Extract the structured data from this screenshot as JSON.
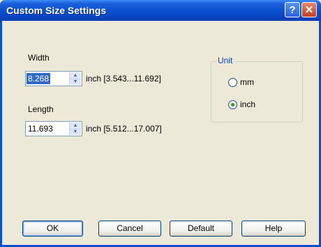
{
  "window": {
    "title": "Custom Size Settings",
    "help_glyph": "?",
    "close_glyph": "✕"
  },
  "width": {
    "label": "Width",
    "value": "8.268",
    "range": "inch [3.543...11.692]"
  },
  "length": {
    "label": "Length",
    "value": "11.693",
    "range": "inch [5.512...17.007]"
  },
  "unit": {
    "title": "Unit",
    "options": [
      {
        "label": "mm",
        "checked": false
      },
      {
        "label": "inch",
        "checked": true
      }
    ]
  },
  "buttons": {
    "ok": "OK",
    "cancel": "Cancel",
    "default": "Default",
    "help": "Help"
  },
  "icons": {
    "spin_up": "▲",
    "spin_down": "▼"
  },
  "colors": {
    "titlebar": "#0a4fd0",
    "dialog_bg": "#ece9d8",
    "selection": "#316ac5",
    "group_title": "#0046d5"
  }
}
